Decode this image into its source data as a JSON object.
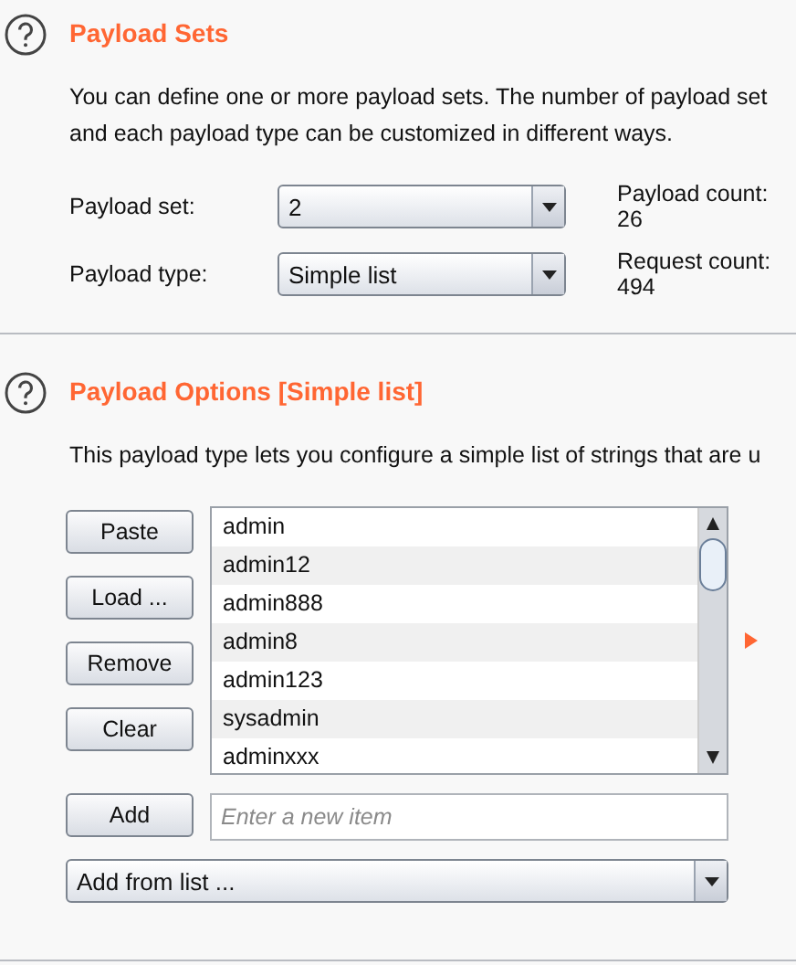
{
  "payload_sets": {
    "title": "Payload Sets",
    "description": [
      "You can define one or more payload sets. The number of payload set",
      "and each payload type can be customized in different ways."
    ],
    "fields": [
      {
        "label": "Payload set:",
        "value": "2",
        "info": "Payload count:  26"
      },
      {
        "label": "Payload type:",
        "value": "Simple list",
        "info": "Request count:  494"
      }
    ]
  },
  "payload_options": {
    "title": "Payload Options [Simple list]",
    "description": "This payload type lets you configure a simple list of strings that are u",
    "buttons": [
      "Paste",
      "Load ...",
      "Remove",
      "Clear"
    ],
    "items": [
      "admin",
      "admin12",
      "admin888",
      "admin8",
      "admin123",
      "sysadmin",
      "adminxxx"
    ],
    "add_button": "Add",
    "new_item": {
      "placeholder": "Enter a new item"
    },
    "add_from_list": "Add from list ..."
  }
}
